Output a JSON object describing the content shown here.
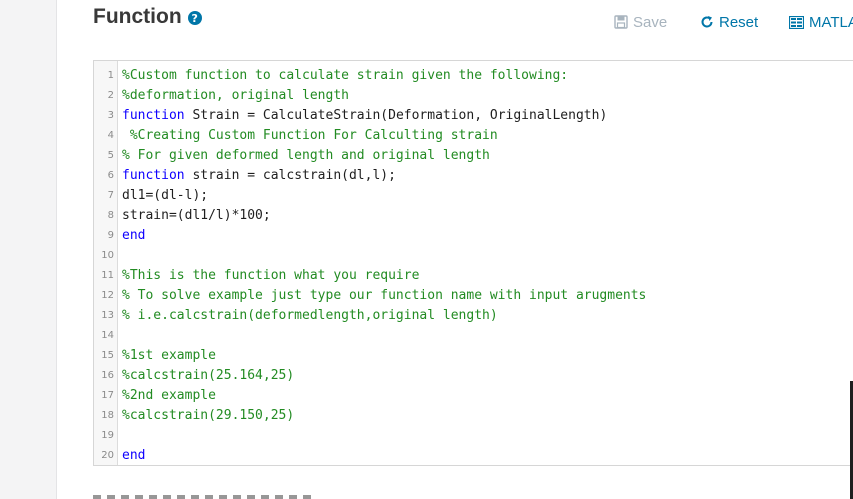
{
  "header": {
    "title": "Function",
    "help_icon": "?"
  },
  "toolbar": {
    "save_label": "Save",
    "reset_label": "Reset",
    "matlab_label": "MATLA",
    "save_icon": "floppy-disk-icon",
    "reset_icon": "refresh-icon",
    "matlab_icon": "matlab-grid-icon"
  },
  "colors": {
    "comment": "#228b22",
    "keyword": "#0e00ff",
    "link": "#0076a8",
    "disabled": "#a8b4be"
  },
  "editor": {
    "lines": [
      {
        "n": "1",
        "tokens": [
          {
            "t": "comment",
            "v": "%Custom function to calculate strain given the following:"
          }
        ]
      },
      {
        "n": "2",
        "tokens": [
          {
            "t": "comment",
            "v": "%deformation, original length"
          }
        ]
      },
      {
        "n": "3",
        "tokens": [
          {
            "t": "keyword",
            "v": "function"
          },
          {
            "t": "plain",
            "v": " Strain = CalculateStrain(Deformation, OriginalLength)"
          }
        ]
      },
      {
        "n": "4",
        "tokens": [
          {
            "t": "comment",
            "v": " %Creating Custom Function For Calculting strain"
          }
        ]
      },
      {
        "n": "5",
        "tokens": [
          {
            "t": "comment",
            "v": "% For given deformed length and original length"
          }
        ]
      },
      {
        "n": "6",
        "tokens": [
          {
            "t": "keyword",
            "v": "function"
          },
          {
            "t": "plain",
            "v": " strain = calcstrain(dl,l);"
          }
        ]
      },
      {
        "n": "7",
        "tokens": [
          {
            "t": "plain",
            "v": "dl1=(dl-l);"
          }
        ]
      },
      {
        "n": "8",
        "tokens": [
          {
            "t": "plain",
            "v": "strain=(dl1/l)*100;"
          }
        ]
      },
      {
        "n": "9",
        "tokens": [
          {
            "t": "keyword",
            "v": "end"
          }
        ]
      },
      {
        "n": "10",
        "tokens": []
      },
      {
        "n": "11",
        "tokens": [
          {
            "t": "comment",
            "v": "%This is the function what you require"
          }
        ]
      },
      {
        "n": "12",
        "tokens": [
          {
            "t": "comment",
            "v": "% To solve example just type our function name with input arugments"
          }
        ]
      },
      {
        "n": "13",
        "tokens": [
          {
            "t": "comment",
            "v": "% i.e.calcstrain(deformedlength,original length)"
          }
        ]
      },
      {
        "n": "14",
        "tokens": []
      },
      {
        "n": "15",
        "tokens": [
          {
            "t": "comment",
            "v": "%1st example"
          }
        ]
      },
      {
        "n": "16",
        "tokens": [
          {
            "t": "comment",
            "v": "%calcstrain(25.164,25)"
          }
        ]
      },
      {
        "n": "17",
        "tokens": [
          {
            "t": "comment",
            "v": "%2nd example"
          }
        ]
      },
      {
        "n": "18",
        "tokens": [
          {
            "t": "comment",
            "v": "%calcstrain(29.150,25)"
          }
        ]
      },
      {
        "n": "19",
        "tokens": []
      },
      {
        "n": "20",
        "tokens": [
          {
            "t": "keyword",
            "v": "end"
          }
        ]
      }
    ]
  }
}
